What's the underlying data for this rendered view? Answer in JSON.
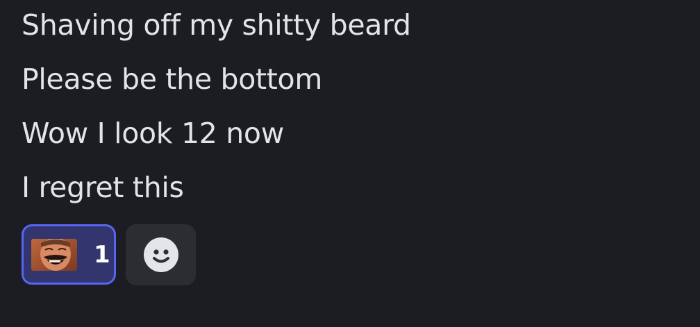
{
  "messages": [
    "Shaving off my shitty beard",
    "Please be the bottom",
    "Wow I look 12 now",
    "I regret this"
  ],
  "reactions": {
    "emoji_icon": "laughing-man-emoji-icon",
    "count": "1",
    "add_icon": "smiley-face-icon"
  },
  "colors": {
    "background": "#1c1d22",
    "text": "#e3e4e8",
    "reaction_active_bg": "#33366e",
    "reaction_active_border": "#5865f2",
    "add_reaction_bg": "#2b2d33"
  }
}
